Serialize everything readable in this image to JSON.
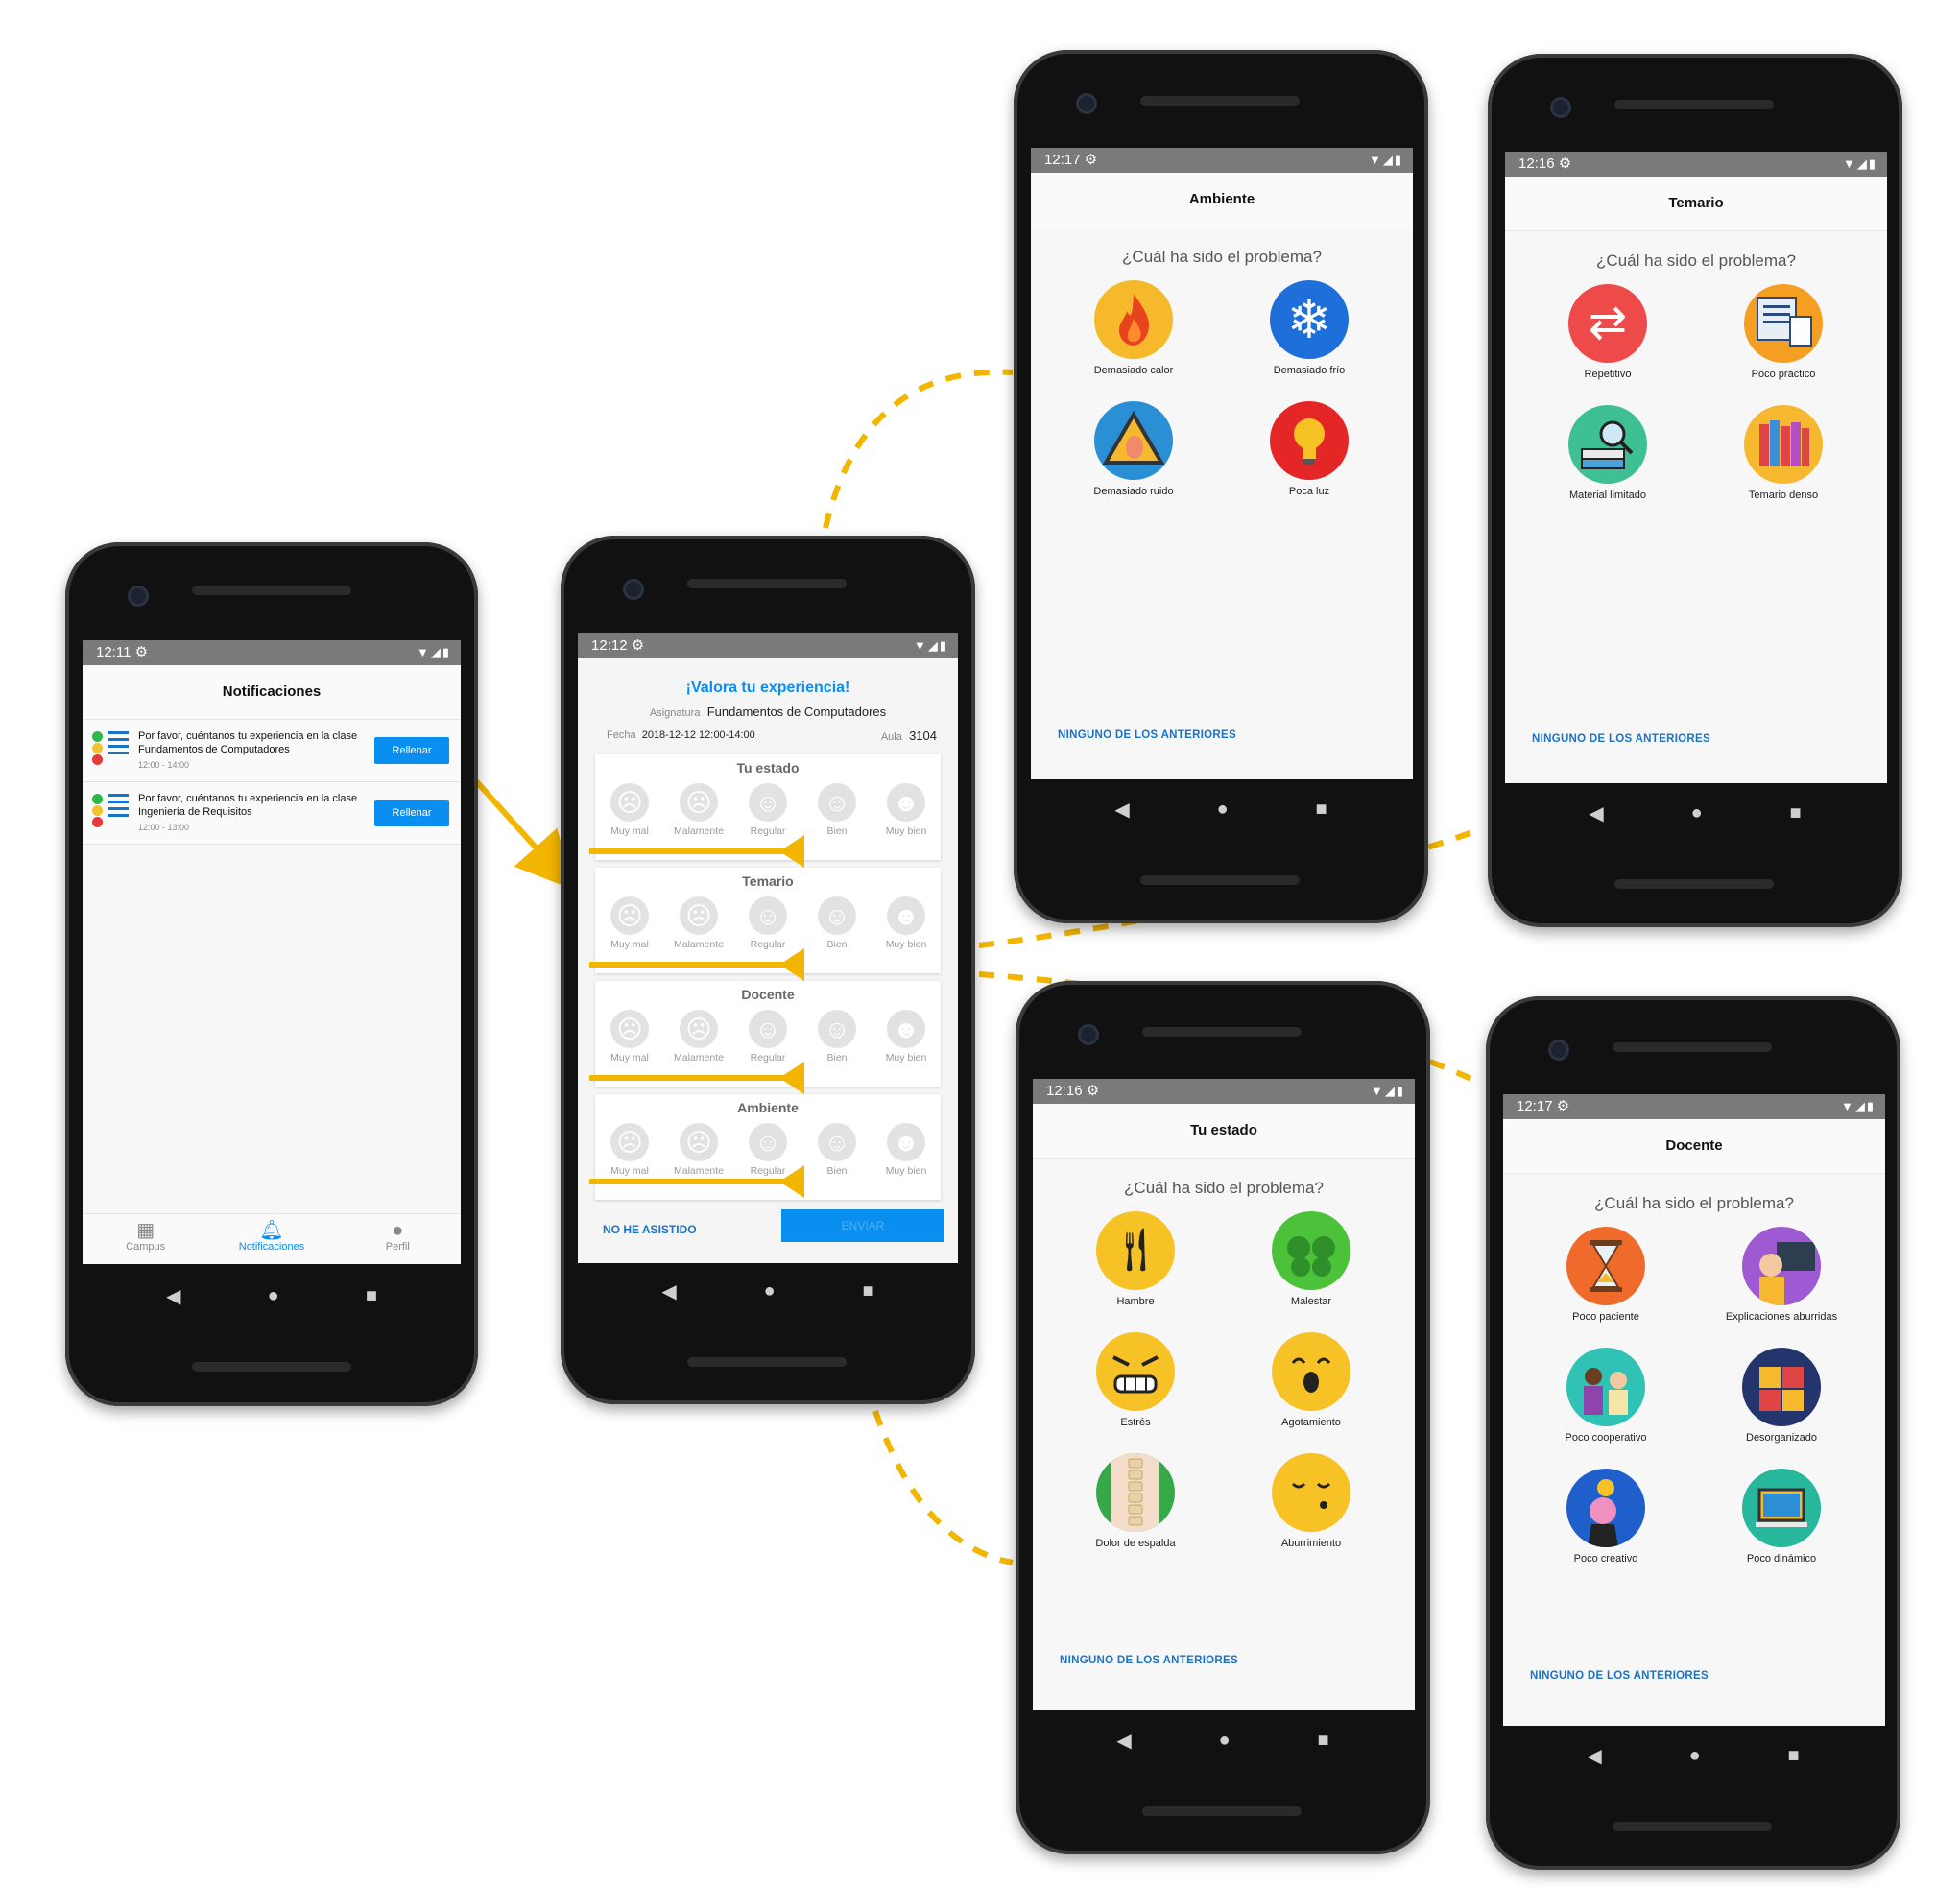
{
  "colors": {
    "accent": "#0a8ef0",
    "link": "#1a73c7",
    "connector": "#f3b600"
  },
  "phone1": {
    "time": "12:11",
    "title": "Notificaciones",
    "notifications": [
      {
        "text": "Por favor, cuéntanos tu experiencia en la clase Fundamentos de Computadores",
        "time": "12:00 - 14:00",
        "button": "Rellenar"
      },
      {
        "text": "Por favor, cuéntanos tu experiencia en la clase Ingeniería de Requisitos",
        "time": "12:00 - 13:00",
        "button": "Rellenar"
      }
    ],
    "nav": [
      {
        "label": "Campus",
        "icon": "building-icon"
      },
      {
        "label": "Notificaciones",
        "icon": "bell-icon"
      },
      {
        "label": "Perfil",
        "icon": "person-icon"
      }
    ]
  },
  "phone2": {
    "time": "12:12",
    "title": "¡Valora tu experiencia!",
    "subject_label": "Asignatura",
    "subject": "Fundamentos de Computadores",
    "date_label": "Fecha",
    "date": "2018-12-12 12:00-14:00",
    "room_label": "Aula",
    "room": "3104",
    "sections": [
      "Tu estado",
      "Temario",
      "Docente",
      "Ambiente"
    ],
    "ratings": [
      "Muy mal",
      "Malamente",
      "Regular",
      "Bien",
      "Muy bien"
    ],
    "not_attended": "NO HE ASISTIDO",
    "send": "ENVIAR"
  },
  "question": "¿Cuál ha sido el problema?",
  "none_option": "NINGUNO DE LOS ANTERIORES",
  "phone_ambiente": {
    "time": "12:17",
    "title": "Ambiente",
    "options": [
      {
        "label": "Demasiado calor",
        "icon": "fire-icon",
        "color": "#f6b92b"
      },
      {
        "label": "Demasiado frío",
        "icon": "snowflake-icon",
        "color": "#1e6fd9"
      },
      {
        "label": "Demasiado ruido",
        "icon": "ear-warning-icon",
        "color": "#2b8fd6"
      },
      {
        "label": "Poca luz",
        "icon": "lightbulb-icon",
        "color": "#e52626"
      }
    ]
  },
  "phone_temario": {
    "time": "12:16",
    "title": "Temario",
    "options": [
      {
        "label": "Repetitivo",
        "icon": "repeat-icon",
        "color": "#ef4a4a"
      },
      {
        "label": "Poco práctico",
        "icon": "documents-icon",
        "color": "#f49e22"
      },
      {
        "label": "Material limitado",
        "icon": "books-magnifier-icon",
        "color": "#3fbf94"
      },
      {
        "label": "Temario denso",
        "icon": "bookshelf-icon",
        "color": "#f5b82e"
      }
    ]
  },
  "phone_estado": {
    "time": "12:16",
    "title": "Tu estado",
    "options": [
      {
        "label": "Hambre",
        "icon": "cutlery-icon",
        "color": "#f7c226"
      },
      {
        "label": "Malestar",
        "icon": "sick-face-icon",
        "color": "#4cc23a"
      },
      {
        "label": "Estrés",
        "icon": "angry-face-icon",
        "color": "#f7c226"
      },
      {
        "label": "Agotamiento",
        "icon": "yawn-face-icon",
        "color": "#f7c226"
      },
      {
        "label": "Dolor de espalda",
        "icon": "spine-icon",
        "color": "#36a84a"
      },
      {
        "label": "Aburrimiento",
        "icon": "bored-face-icon",
        "color": "#f7c226"
      }
    ]
  },
  "phone_docente": {
    "time": "12:17",
    "title": "Docente",
    "options": [
      {
        "label": "Poco paciente",
        "icon": "hourglass-icon",
        "color": "#f06b2b"
      },
      {
        "label": "Explicaciones aburridas",
        "icon": "teacher-icon",
        "color": "#9d5ad3"
      },
      {
        "label": "Poco cooperativo",
        "icon": "people-icon",
        "color": "#2fc2b5"
      },
      {
        "label": "Desorganizado",
        "icon": "puzzle-icon",
        "color": "#24356e"
      },
      {
        "label": "Poco creativo",
        "icon": "idea-head-icon",
        "color": "#1f5fcc"
      },
      {
        "label": "Poco dinámico",
        "icon": "monitor-icon",
        "color": "#26b79d"
      }
    ]
  }
}
